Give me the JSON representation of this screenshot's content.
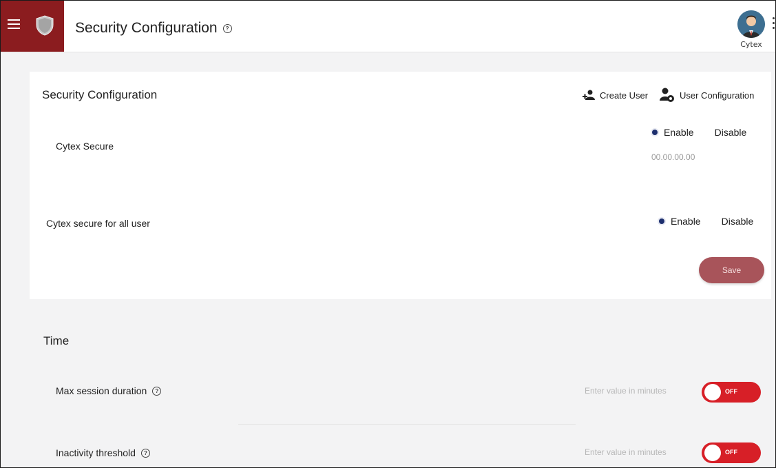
{
  "header": {
    "title": "Security Configuration",
    "user_name": "Cytex"
  },
  "security": {
    "title": "Security Configuration",
    "create_user_label": "Create User",
    "user_config_label": "User Configuration",
    "rows": [
      {
        "label": "Cytex Secure",
        "enable_label": "Enable",
        "disable_label": "Disable",
        "selected": "Enable",
        "ip_value": "00.00.00.00"
      },
      {
        "label": "Cytex secure for all user",
        "enable_label": "Enable",
        "disable_label": "Disable",
        "selected": "Enable"
      }
    ],
    "save_label": "Save"
  },
  "time": {
    "title": "Time",
    "rows": [
      {
        "label": "Max session duration",
        "placeholder": "Enter value in minutes",
        "toggle_label": "OFF"
      },
      {
        "label": "Inactivity threshold",
        "placeholder": "Enter value in minutes",
        "toggle_label": "OFF"
      }
    ]
  },
  "colors": {
    "brand": "#8b1c1f",
    "save_button": "#a8545a",
    "toggle_off": "#d71f27",
    "radio_selected": "#1d2f6e"
  }
}
